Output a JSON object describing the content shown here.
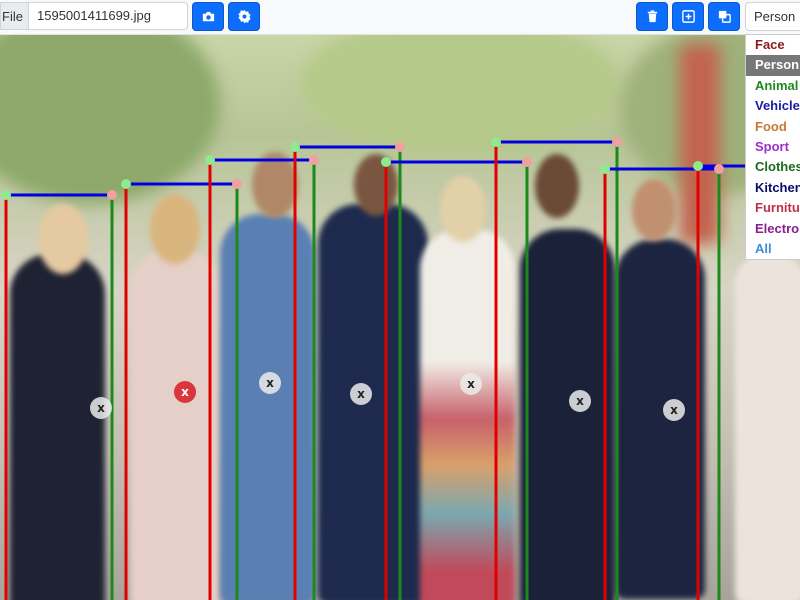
{
  "toolbar": {
    "file_label": "File",
    "file_name": "1595001411699.jpg",
    "buttons": [
      {
        "name": "camera-button",
        "icon": "camera-icon"
      },
      {
        "name": "settings-button",
        "icon": "gear-icon"
      },
      {
        "name": "delete-button",
        "icon": "trash-icon"
      },
      {
        "name": "add-box-button",
        "icon": "plus-square-icon"
      },
      {
        "name": "copy-box-button",
        "icon": "copy-icon"
      }
    ],
    "category_selected": "Person"
  },
  "categories": [
    {
      "label": "Face",
      "color": "#8b1a1a"
    },
    {
      "label": "Person",
      "color": "#555555"
    },
    {
      "label": "Animal",
      "color": "#1f8a1f"
    },
    {
      "label": "Vehicle",
      "color": "#1a1aa6"
    },
    {
      "label": "Food",
      "color": "#c87a32"
    },
    {
      "label": "Sport",
      "color": "#9b30c8"
    },
    {
      "label": "Clothes",
      "color": "#1c6b1c"
    },
    {
      "label": "Kitchen",
      "color": "#0b0b6b"
    },
    {
      "label": "Furniture",
      "color": "#c0304a"
    },
    {
      "label": "Electronics",
      "color": "#8a2090"
    },
    {
      "label": "All",
      "color": "#3a8fd8"
    }
  ],
  "remove_marker_label": "x",
  "colors": {
    "accent": "#0d6efd",
    "box_left": "#e00000",
    "box_right": "#1a8a1a",
    "box_top": "#0000e0"
  }
}
